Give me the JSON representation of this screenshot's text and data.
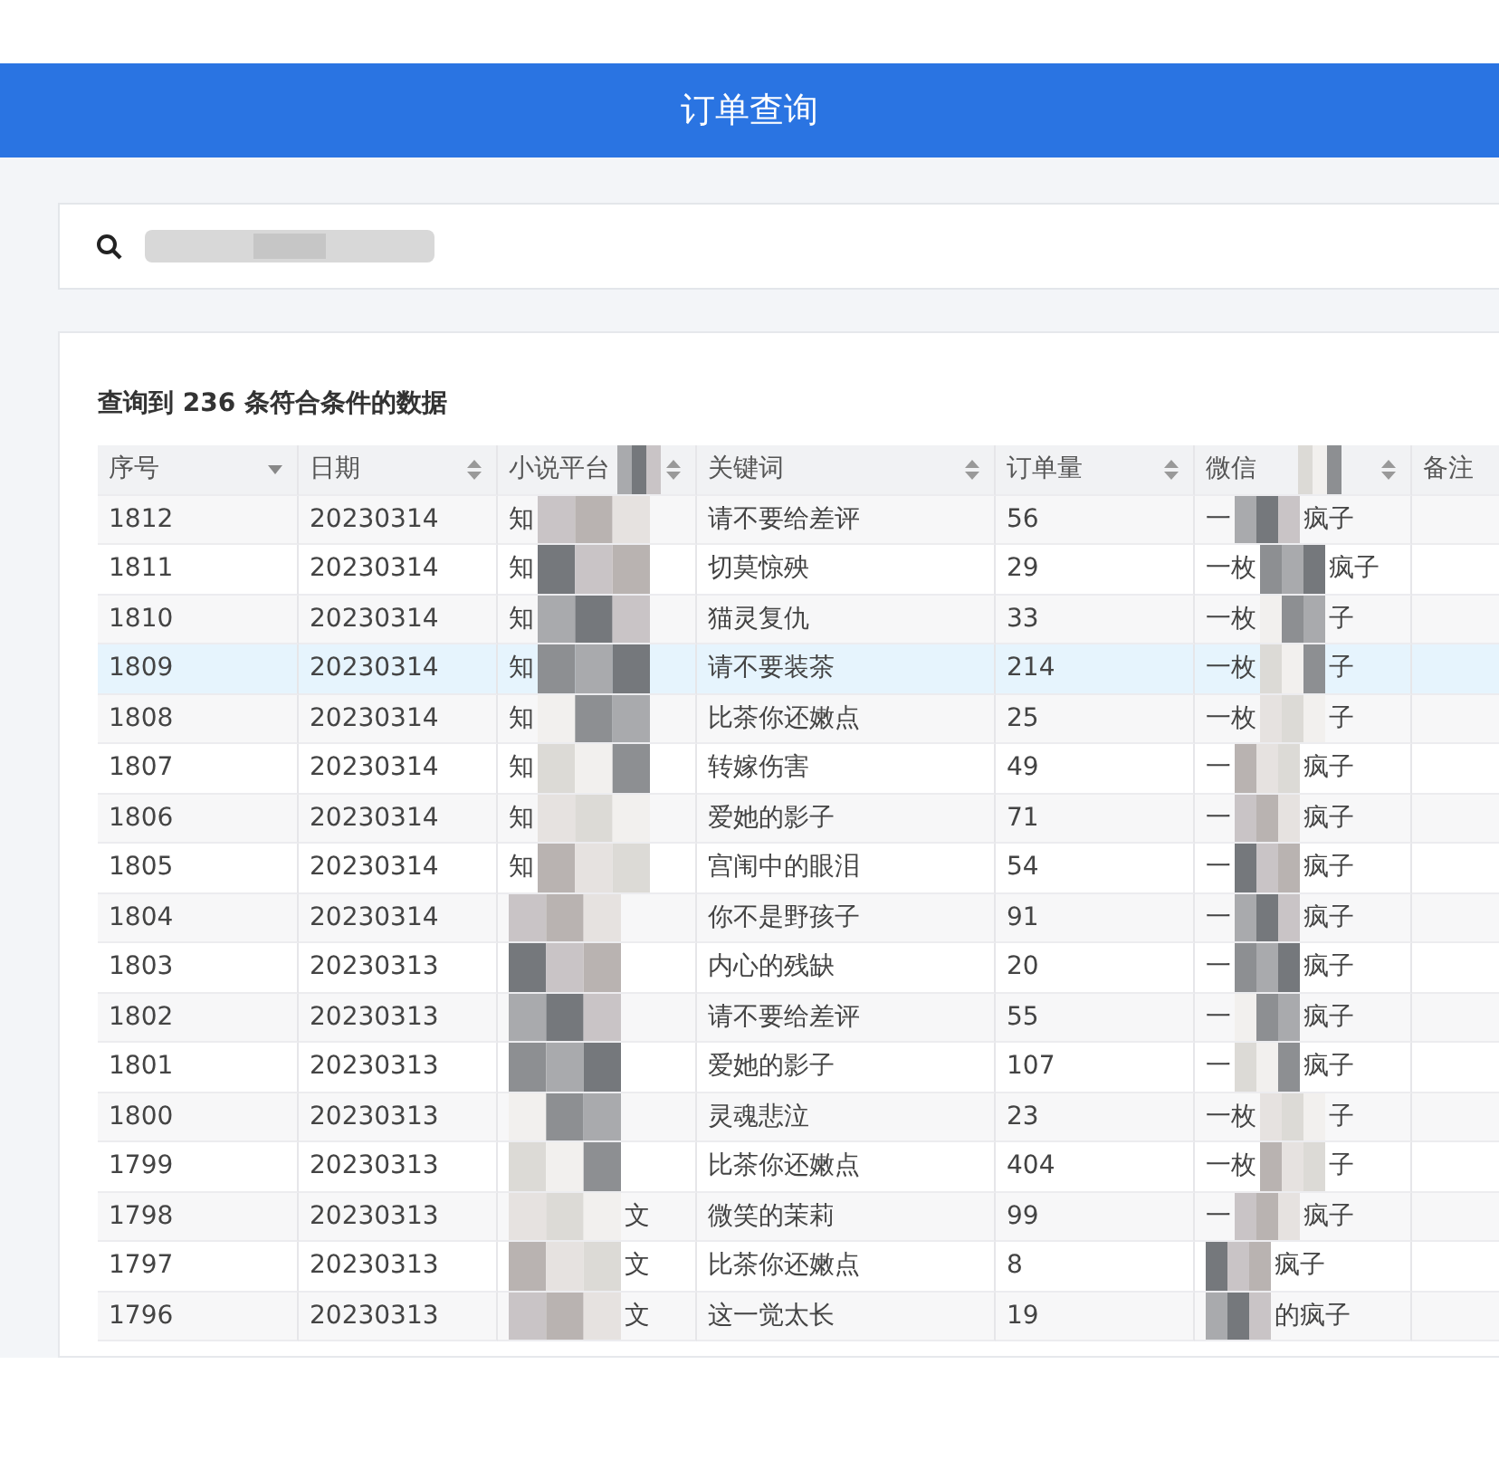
{
  "header": {
    "title": "订单查询"
  },
  "search": {
    "redacted": true
  },
  "result_summary": "查询到 236 条符合条件的数据",
  "table": {
    "columns": [
      {
        "label": "序号",
        "sortable": true,
        "sorted": true
      },
      {
        "label": "日期",
        "sortable": true,
        "sorted": false
      },
      {
        "label": "小说平台",
        "sortable": true,
        "sorted": false,
        "redacted": true
      },
      {
        "label": "关键词",
        "sortable": true,
        "sorted": false
      },
      {
        "label": "订单量",
        "sortable": true,
        "sorted": false
      },
      {
        "label": "微信",
        "sortable": true,
        "sorted": false,
        "redacted": true
      },
      {
        "label": "备注"
      }
    ],
    "rows": [
      {
        "id": "1812",
        "date": "20230314",
        "platform": {
          "left": "知"
        },
        "keyword": "请不要给差评",
        "orders": "56",
        "wechat": {
          "left": "一",
          "right": "疯子"
        },
        "selected": false
      },
      {
        "id": "1811",
        "date": "20230314",
        "platform": {
          "left": "知"
        },
        "keyword": "切莫惊殃",
        "orders": "29",
        "wechat": {
          "left": "一枚",
          "right": "疯子"
        },
        "selected": false
      },
      {
        "id": "1810",
        "date": "20230314",
        "platform": {
          "left": "知"
        },
        "keyword": "猫灵复仇",
        "orders": "33",
        "wechat": {
          "left": "一枚",
          "right": "子"
        },
        "selected": false
      },
      {
        "id": "1809",
        "date": "20230314",
        "platform": {
          "left": "知"
        },
        "keyword": "请不要装茶",
        "orders": "214",
        "wechat": {
          "left": "一枚",
          "right": "子"
        },
        "selected": true
      },
      {
        "id": "1808",
        "date": "20230314",
        "platform": {
          "left": "知"
        },
        "keyword": "比茶你还嫩点",
        "orders": "25",
        "wechat": {
          "left": "一枚",
          "right": "子"
        },
        "selected": false
      },
      {
        "id": "1807",
        "date": "20230314",
        "platform": {
          "left": "知"
        },
        "keyword": "转嫁伤害",
        "orders": "49",
        "wechat": {
          "left": "一",
          "right": "疯子"
        },
        "selected": false
      },
      {
        "id": "1806",
        "date": "20230314",
        "platform": {
          "left": "知"
        },
        "keyword": "爱她的影子",
        "orders": "71",
        "wechat": {
          "left": "一",
          "right": "疯子"
        },
        "selected": false
      },
      {
        "id": "1805",
        "date": "20230314",
        "platform": {
          "left": "知"
        },
        "keyword": "宫闱中的眼泪",
        "orders": "54",
        "wechat": {
          "left": "一",
          "right": "疯子"
        },
        "selected": false
      },
      {
        "id": "1804",
        "date": "20230314",
        "platform": {},
        "keyword": "你不是野孩子",
        "orders": "91",
        "wechat": {
          "left": "一",
          "right": "疯子"
        },
        "selected": false
      },
      {
        "id": "1803",
        "date": "20230313",
        "platform": {},
        "keyword": "内心的残缺",
        "orders": "20",
        "wechat": {
          "left": "一",
          "right": "疯子"
        },
        "selected": false
      },
      {
        "id": "1802",
        "date": "20230313",
        "platform": {},
        "keyword": "请不要给差评",
        "orders": "55",
        "wechat": {
          "left": "一",
          "right": "疯子"
        },
        "selected": false
      },
      {
        "id": "1801",
        "date": "20230313",
        "platform": {},
        "keyword": "爱她的影子",
        "orders": "107",
        "wechat": {
          "left": "一",
          "right": "疯子"
        },
        "selected": false
      },
      {
        "id": "1800",
        "date": "20230313",
        "platform": {},
        "keyword": "灵魂悲泣",
        "orders": "23",
        "wechat": {
          "left": "一枚",
          "right": "子"
        },
        "selected": false
      },
      {
        "id": "1799",
        "date": "20230313",
        "platform": {},
        "keyword": "比茶你还嫩点",
        "orders": "404",
        "wechat": {
          "left": "一枚",
          "right": "子"
        },
        "selected": false
      },
      {
        "id": "1798",
        "date": "20230313",
        "platform": {
          "right": "文"
        },
        "keyword": "微笑的茉莉",
        "orders": "99",
        "wechat": {
          "left": "一",
          "right": "疯子"
        },
        "selected": false
      },
      {
        "id": "1797",
        "date": "20230313",
        "platform": {
          "right": "文"
        },
        "keyword": "比茶你还嫩点",
        "orders": "8",
        "wechat": {
          "right": "疯子"
        },
        "selected": false
      },
      {
        "id": "1796",
        "date": "20230313",
        "platform": {
          "right": "文"
        },
        "keyword": "这一觉太长",
        "orders": "19",
        "wechat": {
          "right": "的疯子"
        },
        "selected": false
      }
    ]
  }
}
